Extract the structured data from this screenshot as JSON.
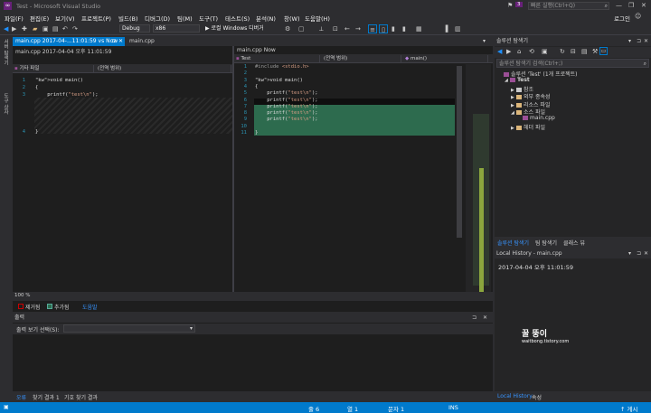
{
  "title": "Test - Microsoft Visual Studio",
  "notification_count": "3",
  "quick_launch_placeholder": "빠른 실행(Ctrl+Q)",
  "signin": "로그인",
  "window_controls": {
    "minimize": "—",
    "restore": "❐",
    "close": "✕"
  },
  "menu": [
    "파일(F)",
    "편집(E)",
    "보기(V)",
    "프로젝트(P)",
    "빌드(B)",
    "디버그(D)",
    "팀(M)",
    "도구(T)",
    "테스트(S)",
    "분석(N)",
    "창(W)",
    "도움말(H)"
  ],
  "toolbar": {
    "config": "Debug",
    "platform": "x86",
    "run_label": "▶ 로컬 Windows 디버거"
  },
  "left_tabs": [
    "서버 탐색기",
    "도구 상자"
  ],
  "diff": {
    "tab_compare": "main.cpp 2017-04-...11:01:59 vs Now",
    "tab_file": "main.cpp",
    "left_caption": "main.cpp 2017-04-04 오후 11:01:59",
    "right_caption": "main.cpp Now",
    "left_nav_scope": "기타 파일",
    "left_nav_member": "(전역 범위)",
    "right_nav_scope": "Test",
    "right_nav_member": "(전역 범위)",
    "right_nav_func": "main()",
    "left_lines": [
      {
        "n": "1",
        "t": "void main()"
      },
      {
        "n": "2",
        "t": "{"
      },
      {
        "n": "3",
        "t": "    printf(\"test\\n\");"
      },
      {
        "n": "",
        "t": ""
      },
      {
        "n": "",
        "t": ""
      },
      {
        "n": "",
        "t": ""
      },
      {
        "n": "",
        "t": ""
      },
      {
        "n": "4",
        "t": "}"
      }
    ],
    "right_lines": [
      {
        "n": "1",
        "t": "#include <stdio.h>"
      },
      {
        "n": "2",
        "t": ""
      },
      {
        "n": "3",
        "t": "void main()"
      },
      {
        "n": "4",
        "t": "{"
      },
      {
        "n": "5",
        "t": "    printf(\"test\\n\");"
      },
      {
        "n": "6",
        "t": "    printf(\"test\\n\");"
      },
      {
        "n": "7",
        "t": "    printf(\"test\\n\");"
      },
      {
        "n": "8",
        "t": "    printf(\"test\\n\");"
      },
      {
        "n": "9",
        "t": "    printf(\"test\\n\");"
      },
      {
        "n": "10",
        "t": ""
      },
      {
        "n": "11",
        "t": "}"
      }
    ],
    "zoom": "100 %",
    "legend_removed": "제거됨",
    "legend_added": "추가됨",
    "legend_link": "도움말"
  },
  "output": {
    "title": "출력",
    "source_label": "출력 보기 선택(S):",
    "tabs": [
      "오류",
      "찾기 결과 1",
      "기호 찾기 결과"
    ]
  },
  "solution_explorer": {
    "title": "솔루션 탐색기",
    "search_placeholder": "솔루션 탐색기 검색(Ctrl+;)",
    "items": [
      {
        "label": "솔루션 'Test' (1개 프로젝트)",
        "level": 0,
        "icon": "solution-icon"
      },
      {
        "label": "Test",
        "level": 1,
        "icon": "project-icon",
        "bold": true
      },
      {
        "label": "참조",
        "level": 2,
        "icon": "references-icon"
      },
      {
        "label": "외부 종속성",
        "level": 2,
        "icon": "folder-icon"
      },
      {
        "label": "리소스 파일",
        "level": 2,
        "icon": "folder-icon"
      },
      {
        "label": "소스 파일",
        "level": 2,
        "icon": "folder-icon"
      },
      {
        "label": "main.cpp",
        "level": 3,
        "icon": "cpp-file-icon"
      },
      {
        "label": "헤더 파일",
        "level": 2,
        "icon": "folder-icon"
      }
    ],
    "bottom_tabs": [
      "솔루션 탐색기",
      "팀 탐색기",
      "클래스 뷰"
    ]
  },
  "local_history": {
    "title": "Local History - main.cpp",
    "entry": "2017-04-04 오후 11:01:59",
    "watermark_main": "꿀 뚱이",
    "watermark_sub": "waitbong.tistory.com",
    "bottom_tabs": [
      "Local History",
      "속성"
    ]
  },
  "status": {
    "line": "줄 6",
    "col": "열 1",
    "ch": "문자 1",
    "mode": "INS",
    "publish": "↑ 게시"
  },
  "colors": {
    "accent": "#007acc",
    "added": "#2d6b4e",
    "diff_bar": "#8ba63d"
  }
}
